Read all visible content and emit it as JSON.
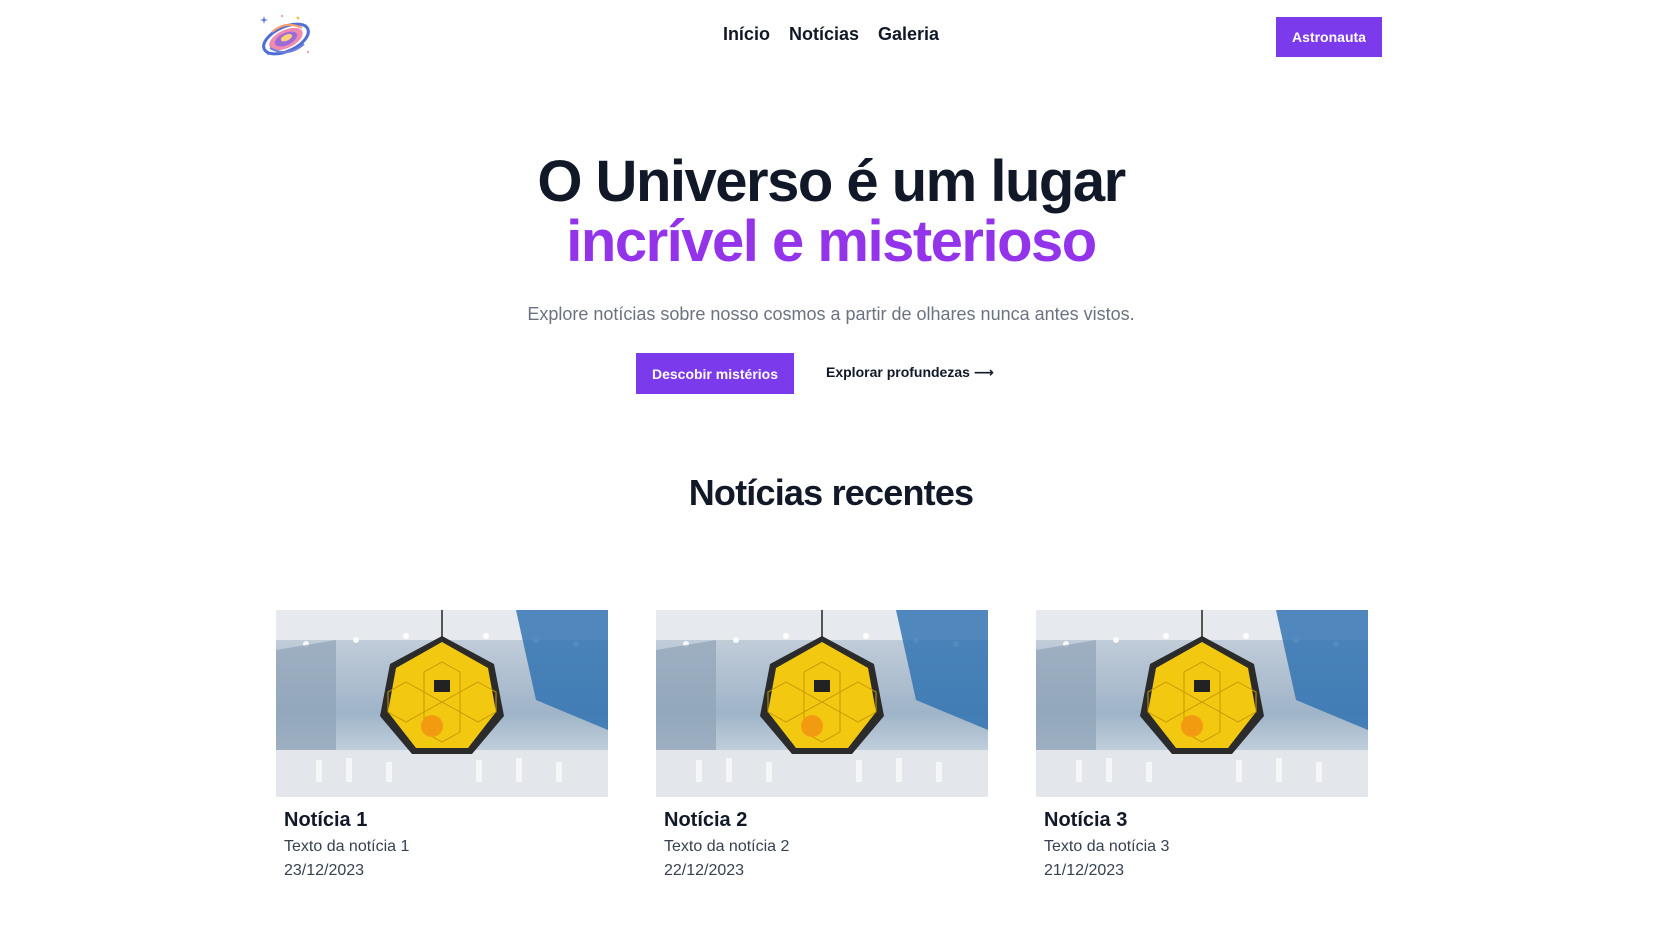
{
  "header": {
    "logo_icon": "galaxy-logo-icon",
    "nav": [
      "Início",
      "Notícias",
      "Galeria"
    ],
    "cta_label": "Astronauta"
  },
  "hero": {
    "title_line1": "O Universo é um lugar",
    "title_line2": "incrível e misterioso",
    "subtitle": "Explore notícias sobre nosso cosmos a partir de olhares nunca antes vistos.",
    "primary_label": "Descobir mistérios",
    "secondary_label": "Explorar profundezas ⟶"
  },
  "recent": {
    "title": "Notícias recentes",
    "cards": [
      {
        "title": "Notícia 1",
        "text": "Texto da notícia 1",
        "date": "23/12/2023"
      },
      {
        "title": "Notícia 2",
        "text": "Texto da notícia 2",
        "date": "22/12/2023"
      },
      {
        "title": "Notícia 3",
        "text": "Texto da notícia 3",
        "date": "21/12/2023"
      }
    ]
  },
  "colors": {
    "accent": "#7c3aed",
    "accent_text": "#9333ea",
    "heading": "#111827",
    "muted": "#6b7280"
  }
}
